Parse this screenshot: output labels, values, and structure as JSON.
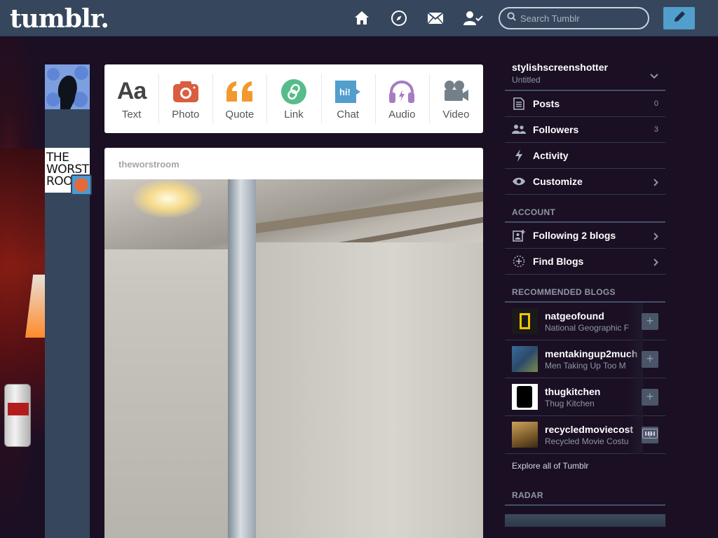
{
  "header": {
    "logo": "tumblr.",
    "search_placeholder": "Search Tumblr",
    "nav_icons": [
      "home-icon",
      "explore-compass-icon",
      "inbox-mail-icon",
      "account-icon"
    ],
    "compose_icon": "pencil-icon",
    "header_color": "#36465d",
    "compose_color": "#529ecc"
  },
  "composer": {
    "types": [
      {
        "label": "Text",
        "icon": "text-aa-icon",
        "color": "#444444"
      },
      {
        "label": "Photo",
        "icon": "camera-icon",
        "color": "#d95e40"
      },
      {
        "label": "Quote",
        "icon": "quote-icon",
        "color": "#f2992e"
      },
      {
        "label": "Link",
        "icon": "link-icon",
        "color": "#56bc8a"
      },
      {
        "label": "Chat",
        "icon": "chat-icon",
        "color": "#529ecc"
      },
      {
        "label": "Audio",
        "icon": "headphones-icon",
        "color": "#a77dc2"
      },
      {
        "label": "Video",
        "icon": "video-camera-icon",
        "color": "#748089"
      }
    ]
  },
  "post": {
    "blog_name": "theworstroom",
    "avatar_text": "THE WORST ROO"
  },
  "sidebar": {
    "blog": {
      "name": "stylishscreenshotter",
      "subtitle": "Untitled"
    },
    "items": [
      {
        "label": "Posts",
        "count": "0",
        "icon": "posts-icon"
      },
      {
        "label": "Followers",
        "count": "3",
        "icon": "followers-icon"
      },
      {
        "label": "Activity",
        "icon": "activity-bolt-icon"
      },
      {
        "label": "Customize",
        "icon": "customize-eye-icon"
      }
    ],
    "account_heading": "ACCOUNT",
    "account_items": [
      {
        "label": "Following 2 blogs",
        "icon": "following-icon"
      },
      {
        "label": "Find Blogs",
        "icon": "find-blogs-icon"
      }
    ],
    "recommended_heading": "RECOMMENDED BLOGS",
    "recommended": [
      {
        "name": "natgeofound",
        "subtitle": "National Geographic F"
      },
      {
        "name": "mentakingup2much",
        "subtitle": "Men Taking Up Too M"
      },
      {
        "name": "thugkitchen",
        "subtitle": "Thug Kitchen"
      },
      {
        "name": "recycledmoviecost",
        "subtitle": "Recycled Movie Costu"
      }
    ],
    "explore": "Explore all of Tumblr",
    "radar_heading": "RADAR"
  }
}
